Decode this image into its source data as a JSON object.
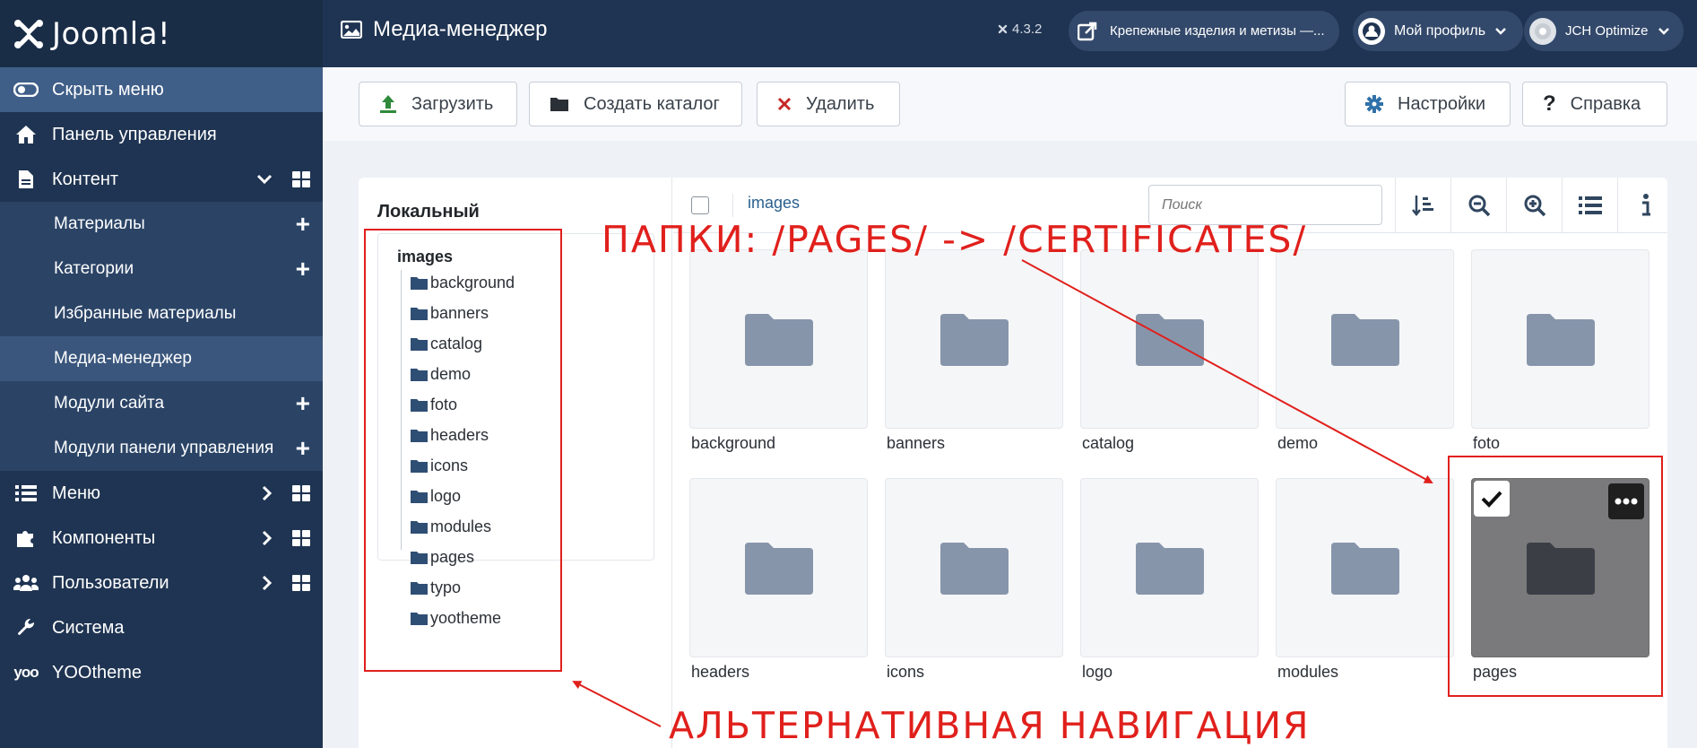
{
  "brand": {
    "name": "Joomla!"
  },
  "sidebar": {
    "toggle_label": "Скрыть меню",
    "items": [
      {
        "label": "Панель управления",
        "icon": "home-icon"
      },
      {
        "label": "Контент",
        "icon": "file-icon"
      },
      {
        "label": "Материалы"
      },
      {
        "label": "Категории"
      },
      {
        "label": "Избранные материалы"
      },
      {
        "label": "Медиа-менеджер"
      },
      {
        "label": "Модули сайта"
      },
      {
        "label": "Модули панели управления"
      },
      {
        "label": "Меню",
        "icon": "list-icon"
      },
      {
        "label": "Компоненты",
        "icon": "puzzle-icon"
      },
      {
        "label": "Пользователи",
        "icon": "users-icon"
      },
      {
        "label": "Система",
        "icon": "wrench-icon"
      },
      {
        "label": "YOOtheme",
        "icon": "yootheme-icon"
      }
    ]
  },
  "header": {
    "title": "Медиа-менеджер",
    "version": "4.3.2",
    "site_link": "Крепежные изделия и метизы —...",
    "profile": "Мой профиль",
    "plugin": "JCH Optimize"
  },
  "toolbar": {
    "upload": "Загрузить",
    "create_folder": "Создать каталог",
    "delete": "Удалить",
    "settings": "Настройки",
    "help": "Справка"
  },
  "tree": {
    "title": "Локальный",
    "root": "images",
    "folders": [
      "background",
      "banners",
      "catalog",
      "demo",
      "foto",
      "headers",
      "icons",
      "logo",
      "modules",
      "pages",
      "typo",
      "yootheme"
    ]
  },
  "browser": {
    "breadcrumb": "images",
    "search_placeholder": "Поиск",
    "tiles": [
      "background",
      "banners",
      "catalog",
      "demo",
      "foto",
      "headers",
      "icons",
      "logo",
      "modules",
      "pages"
    ],
    "selected": "pages"
  },
  "annotations": {
    "top": "ПАПКИ: /PAGES/ -> /CERTIFICATES/",
    "bottom": "АЛЬТЕРНАТИВНАЯ НАВИГАЦИЯ"
  },
  "colors": {
    "sidebar": "#1f3452",
    "annotation": "#e0201c",
    "link": "#2a5f8f"
  }
}
